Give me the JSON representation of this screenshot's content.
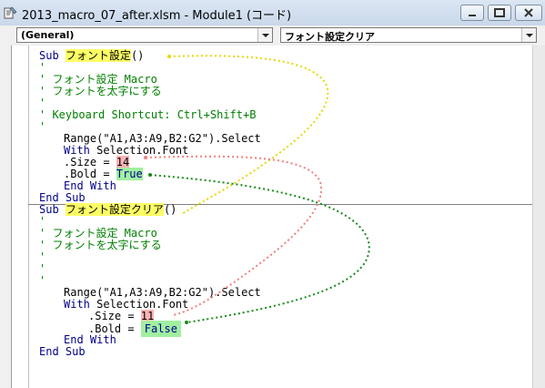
{
  "window": {
    "title": "2013_macro_07_after.xlsm - Module1 (コード)",
    "min_glyph": "",
    "max_glyph": "",
    "close_glyph": ""
  },
  "combos": {
    "object": "(General)",
    "procedure": "フォント設定クリア"
  },
  "code": {
    "block1": {
      "sub_kw": "Sub",
      "name": "フォント設定",
      "parens": "()",
      "c1": "'",
      "c2": "' フォント設定 Macro",
      "c3": "' フォントを太字にする",
      "c4": "'",
      "c5": "' Keyboard Shortcut: Ctrl+Shift+B",
      "c6": "'",
      "range": "Range(\"A1,A3:A9,B2:G2\").Select",
      "with_kw": "With",
      "with_rest": " Selection.Font",
      "size_pre": ".Size = ",
      "size_val": "14",
      "bold_pre": ".Bold = ",
      "bold_val": "True",
      "endwith": "End With",
      "endsub": "End Sub"
    },
    "block2": {
      "sub_kw": "Sub",
      "name": "フォント設定クリア",
      "parens": "()",
      "c1": "'",
      "c2": "' フォント設定 Macro",
      "c3": "' フォントを太字にする",
      "c4": "'",
      "c5": "'",
      "c6": "'",
      "range": "Range(\"A1,A3:A9,B2:G2\").Select",
      "with_kw": "With",
      "with_rest": " Selection.Font",
      "size_pre": ".Size = ",
      "size_val": "11",
      "bold_pre": ".Bold = ",
      "bold_val": "False",
      "endwith": "End With",
      "endsub": "End Sub"
    }
  },
  "colors": {
    "keyword": "#00008b",
    "comment": "#008000",
    "highlight_yellow": "#ffff66",
    "highlight_pink": "#ffb3b3",
    "highlight_green": "#a0f0a0"
  }
}
